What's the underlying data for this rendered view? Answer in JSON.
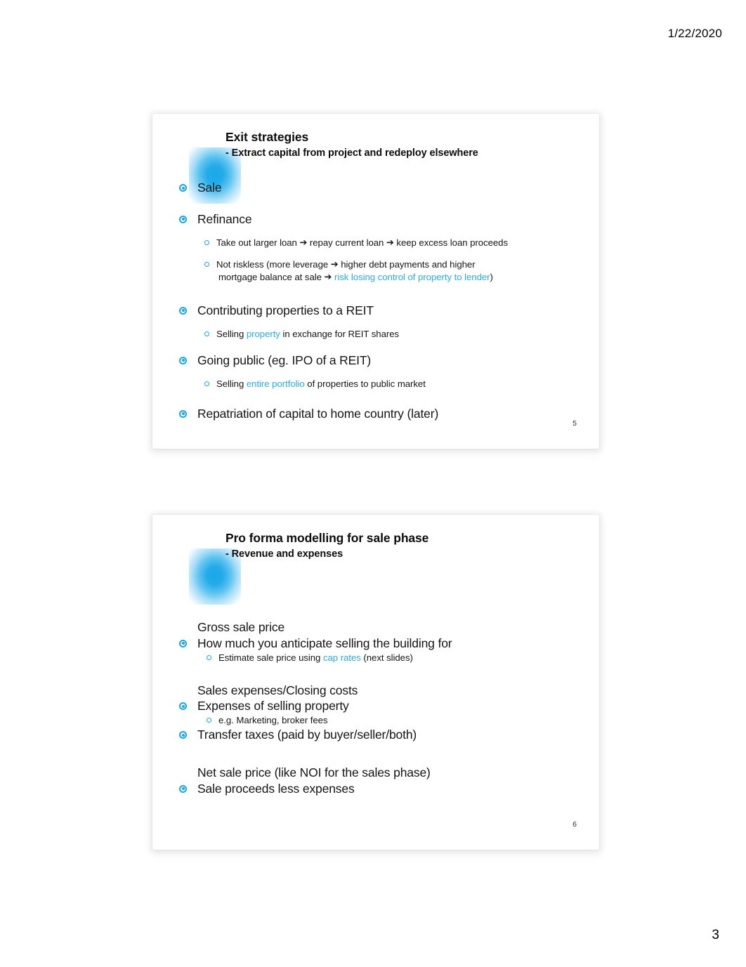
{
  "page": {
    "date": "1/22/2020",
    "number": "3"
  },
  "slides": [
    {
      "title": "Exit strategies",
      "subtitle": "- Extract capital from project and redeploy elsewhere",
      "number": "5",
      "items": {
        "sale": "Sale",
        "refinance": "Refinance",
        "refi_sub1_a": "Take out larger loan",
        "refi_sub1_arrow1": "➔",
        "refi_sub1_b": "repay current loan",
        "refi_sub1_arrow2": "➔",
        "refi_sub1_c": "keep excess loan proceeds",
        "refi_sub2_a": "Not riskless (more leverage",
        "refi_sub2_arrow1": "➔",
        "refi_sub2_b": "higher debt payments and higher",
        "refi_sub2_c": "mortgage balance at sale",
        "refi_sub2_arrow2": "➔",
        "refi_sub2_highlight": "risk losing control of property to lender",
        "refi_sub2_d": ")",
        "reit": "Contributing properties to a REIT",
        "reit_sub_a": "Selling",
        "reit_sub_hl": "property",
        "reit_sub_b": "in exchange for REIT shares",
        "going_public": "Going public (eg. IPO of a REIT)",
        "going_sub_a": "Selling",
        "going_sub_hl": "entire portfolio",
        "going_sub_b": "of properties to public market",
        "repatriation": "Repatriation of capital to home country (later)"
      }
    },
    {
      "title": "Pro forma modelling for sale phase",
      "subtitle": "- Revenue and expenses",
      "number": "6",
      "items": {
        "gross_heading": "Gross sale price",
        "gross_bullet": "How much you anticipate selling the building for",
        "gross_sub_a": "Estimate sale price using",
        "gross_sub_hl": "cap rates",
        "gross_sub_b": "(next slides)",
        "expenses_heading": "Sales expenses/Closing costs",
        "expenses_bullet": "Expenses of selling property",
        "expenses_sub": "e.g. Marketing, broker fees",
        "transfer_taxes": "Transfer taxes (paid by buyer/seller/both)",
        "net_heading": "Net sale price (like NOI for the sales phase)",
        "net_bullet": "Sale proceeds less expenses"
      }
    }
  ],
  "colors": {
    "accent": "#29ABE2",
    "bullet": "#16A8E6",
    "text": "#151515"
  }
}
